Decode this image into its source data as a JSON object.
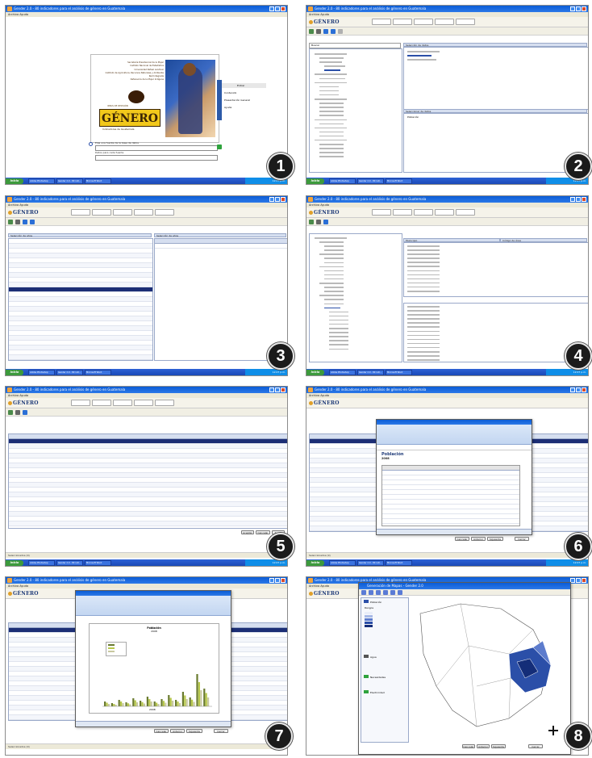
{
  "colors": {
    "titlebar": "#0a5cd6",
    "selection": "#1c2e75",
    "accent": "#2b4fa8",
    "badge": "#1b1b1b"
  },
  "badges": [
    "1",
    "2",
    "3",
    "4",
    "5",
    "6",
    "7",
    "8"
  ],
  "screens": {
    "s1": {
      "title": "Gender 2.0 - 80 indicadores para el análisis de género en Guatemala",
      "menu": "Archivo  Ayuda",
      "splash_lines": [
        "Secretaría Presidencial de la Mujer",
        "Instituto Nacional de Estadística",
        "Universidad Rafael Landívar",
        "Instituto de Agricultura, Recursos Naturales y Ambiente",
        "Red Integrada",
        "Defensoría de la Mujer Indígena"
      ],
      "splash_brand": "GÉNERO",
      "splash_subtitle": "Indicadores de Guatemala",
      "splash_tag": "IDEAS DE DECISIÓN",
      "side_menu": [
        "Entrar",
        "Contenido",
        "Presentación General",
        "Ayuda"
      ],
      "search_label": "Elija una fuente de la base de datos",
      "path_label": "Datos para cada fuente"
    },
    "s2": {
      "search": "Buscar",
      "panel_title": "Selección de datos",
      "bottom_title": "Seleccionar de datos",
      "bottom_item": "Población"
    },
    "s3": {
      "left_title": "Selección de años",
      "right_title": "Selección de años"
    },
    "s4": {
      "left_header": "Municipio",
      "right_header": "Código de Área"
    },
    "s5": {
      "buttons": [
        "Aceptar",
        "Cancelar",
        "Ayuda"
      ],
      "status": "Seleccionados (9)"
    },
    "s6": {
      "sheet_title": "Población",
      "sheet_year": "2008",
      "buttons": [
        "Cancelar",
        "Anterior",
        "Siguiente",
        "Cerrar"
      ]
    },
    "s7": {
      "chart_title": "Población",
      "chart_subtitle": "2008",
      "chart_year": "2008"
    },
    "s8": {
      "window_title": "Generación de Mapas - Gender 2.0",
      "layers": [
        "Población",
        "Agua",
        "Necesidades",
        "Electricidad"
      ],
      "legend_label": "Rangos"
    }
  },
  "taskbar": {
    "start": "Inicio",
    "tasks": [
      "Adobe Photoshop",
      "Gender 2.0 - 80 indi...",
      "Microsoft Word",
      "2013_GENERO"
    ],
    "clock": "12:07 p.m."
  }
}
